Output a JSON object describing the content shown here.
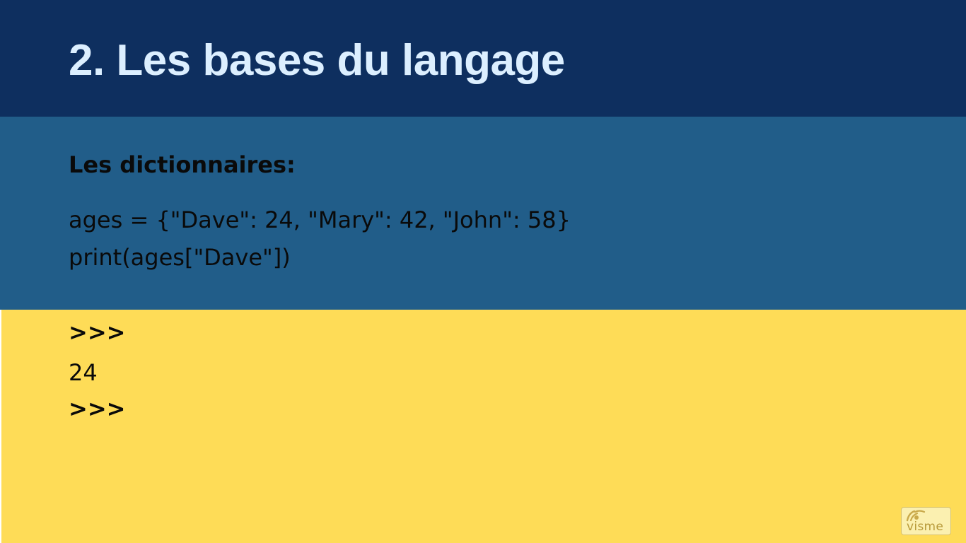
{
  "slide": {
    "title": "2. Les bases du langage",
    "subtitle": "Les dictionnaires:",
    "code": {
      "line_1": "ages = {\"Dave\": 24, \"Mary\": 42, \"John\": 58}",
      "line_2": "print(ages[\"Dave\"])"
    },
    "output": {
      "line_1": ">>>",
      "line_2": "24",
      "line_3": ">>>"
    },
    "watermark": {
      "text": "visme",
      "icon": "visme-logo-icon"
    }
  },
  "colors": {
    "header_bg": "#0e2f5f",
    "title_text": "#dcefff",
    "code_band_bg": "#215d89",
    "output_band_bg": "#fedc57",
    "body_text": "#0a0a0a",
    "watermark_text": "#b89a3a"
  }
}
